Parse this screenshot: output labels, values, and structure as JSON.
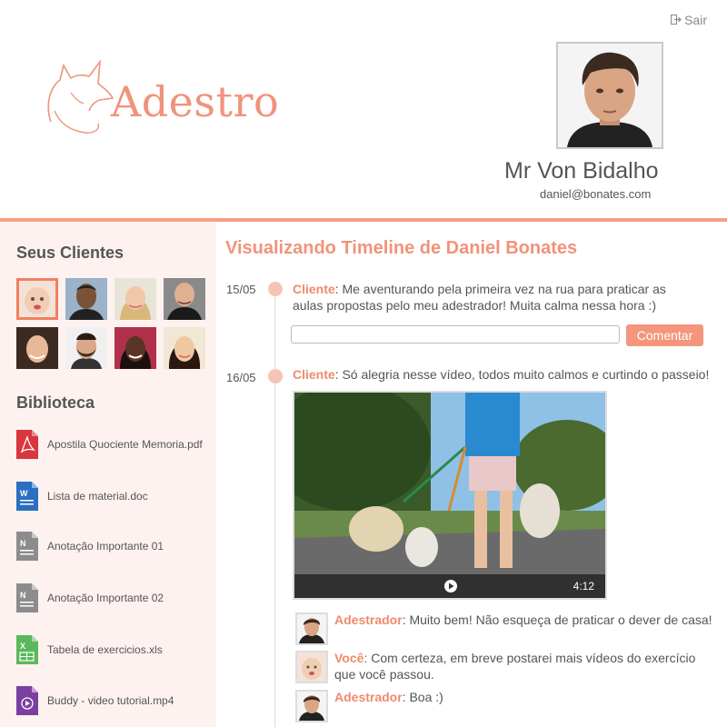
{
  "header": {
    "logout_label": "Sair",
    "logo_text": "Adestro",
    "user_name": "Mr Von Bidalho",
    "user_email": "daniel@bonates.com"
  },
  "colors": {
    "accent": "#f0937b",
    "accent_dark": "#f08a6c",
    "sidebar_bg": "#fdf2ef",
    "button_bg": "#f3967c"
  },
  "sidebar": {
    "clients_title": "Seus Clientes",
    "clients_count": 8,
    "library_title": "Biblioteca",
    "library": [
      {
        "label": "Apostila Quociente Memoria.pdf",
        "icon": "pdf-file-icon"
      },
      {
        "label": "Lista de material.doc",
        "icon": "word-file-icon"
      },
      {
        "label": "Anotação Importante 01",
        "icon": "note-file-icon"
      },
      {
        "label": "Anotação Importante 02",
        "icon": "note-file-icon"
      },
      {
        "label": "Tabela de exercicios.xls",
        "icon": "excel-file-icon"
      },
      {
        "label": "Buddy - video tutorial.mp4",
        "icon": "video-file-icon"
      }
    ]
  },
  "main": {
    "title": "Visualizando Timeline de Daniel Bonates",
    "comment_button": "Comentar",
    "comment_placeholder": "",
    "posts": [
      {
        "date": "15/05",
        "author": "Cliente",
        "text": ": Me aventurando pela primeira vez na rua para praticar as aulas propostas pelo meu adestrador! Muita calma nessa hora :)"
      },
      {
        "date": "16/05",
        "author": "Cliente",
        "text": ": Só alegria nesse vídeo, todos muito calmos e curtindo o passeio!",
        "video_duration": "4:12"
      }
    ],
    "replies": [
      {
        "author": "Adestrador",
        "text": ": Muito bem! Não esqueça de praticar o dever de casa!"
      },
      {
        "author": "Você",
        "text": ": Com certeza, em breve postarei mais vídeos do exercício que você passou."
      },
      {
        "author": "Adestrador",
        "text": ": Boa :)"
      }
    ]
  }
}
